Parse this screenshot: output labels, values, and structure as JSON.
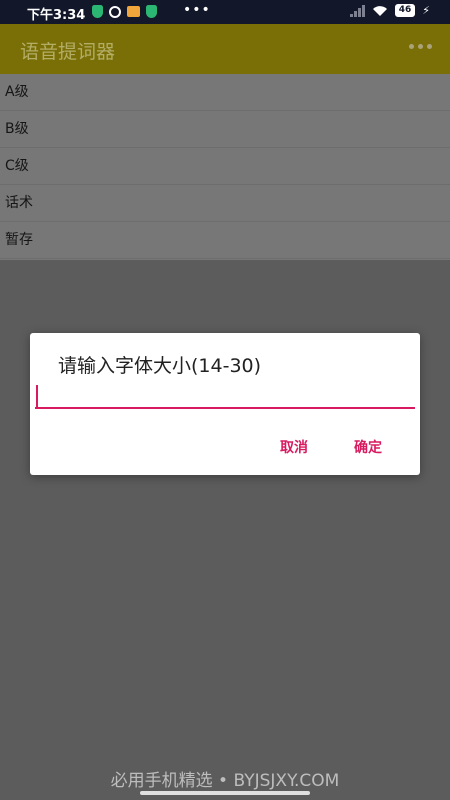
{
  "status_bar": {
    "time": "下午3:34",
    "dots": "•••",
    "battery": "46",
    "colors": {
      "shield": "#2bb673",
      "message": "#f0a63a"
    }
  },
  "app_bar": {
    "title": "语音提词器",
    "menu_icon": "more-horizontal-icon",
    "color": "#7a6f06"
  },
  "list": {
    "items": [
      "A级",
      "B级",
      "C级",
      "话术",
      "暂存"
    ]
  },
  "dialog": {
    "title": "请输入字体大小(14-30)",
    "input_value": "",
    "cancel_label": "取消",
    "ok_label": "确定",
    "accent": "#d81b60"
  },
  "watermark": "必用手机精选 • BYJSJXY.COM"
}
